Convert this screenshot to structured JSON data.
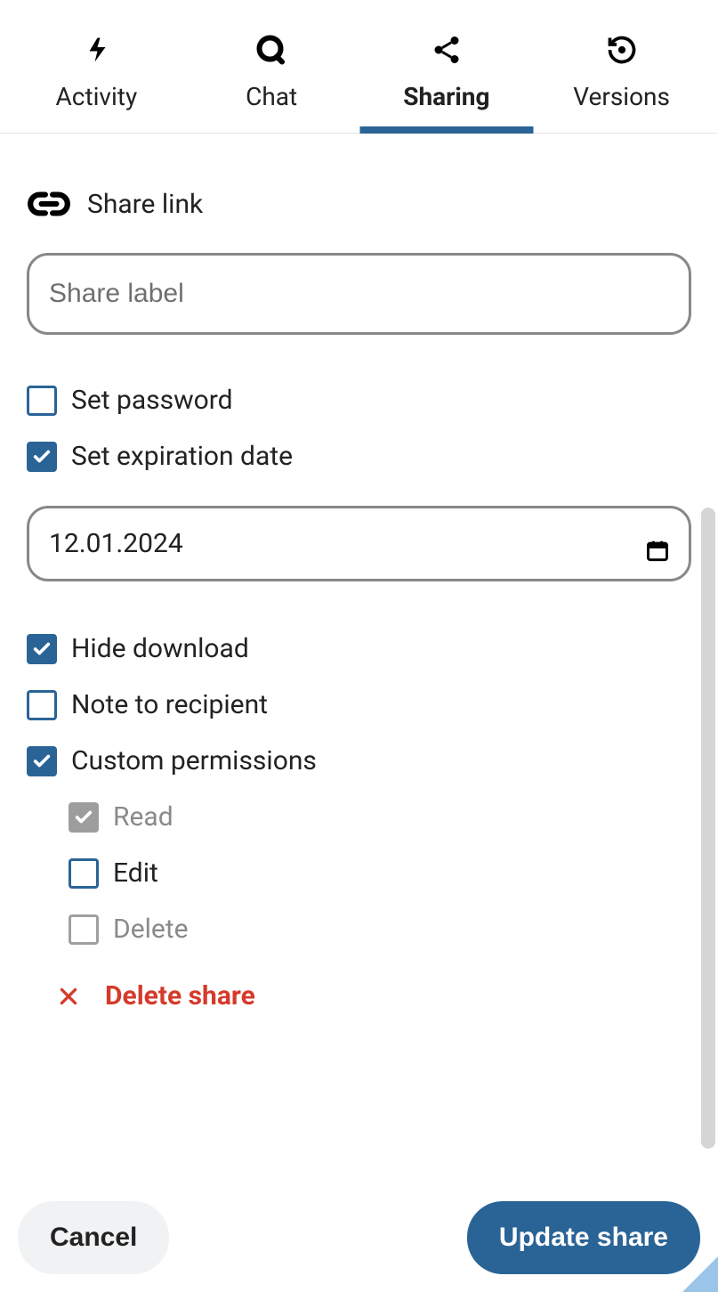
{
  "tabs": {
    "activity": "Activity",
    "chat": "Chat",
    "sharing": "Sharing",
    "versions": "Versions"
  },
  "section": {
    "share_link": "Share link"
  },
  "fields": {
    "share_label_placeholder": "Share label",
    "share_label_value": "",
    "date_value": "12.01.2024"
  },
  "options": {
    "set_password": "Set password",
    "set_expiration": "Set expiration date",
    "hide_download": "Hide download",
    "note_recipient": "Note to recipient",
    "custom_permissions": "Custom permissions",
    "read": "Read",
    "edit": "Edit",
    "delete": "Delete"
  },
  "actions": {
    "delete_share": "Delete share",
    "cancel": "Cancel",
    "update_share": "Update share"
  }
}
